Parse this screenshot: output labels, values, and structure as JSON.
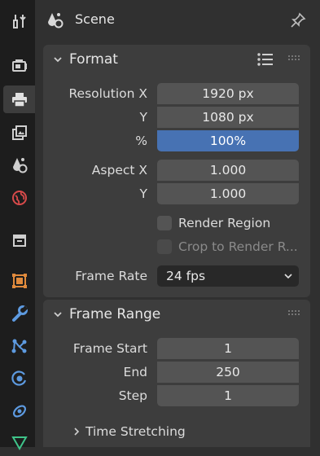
{
  "header": {
    "title": "Scene"
  },
  "tabs": [
    {
      "name": "tool-tab",
      "icon": "tool-icon"
    },
    {
      "name": "render-tab",
      "icon": "render-icon"
    },
    {
      "name": "output-tab",
      "icon": "output-icon",
      "active": true
    },
    {
      "name": "view-layer-tab",
      "icon": "view-layer-icon"
    },
    {
      "name": "scene-tab",
      "icon": "scene-icon"
    },
    {
      "name": "world-tab",
      "icon": "world-icon"
    },
    {
      "name": "collection-tab",
      "icon": "collection-icon"
    },
    {
      "name": "object-tab",
      "icon": "object-icon"
    },
    {
      "name": "modifier-tab",
      "icon": "wrench-icon"
    },
    {
      "name": "particles-tab",
      "icon": "particles-icon"
    },
    {
      "name": "physics-tab",
      "icon": "physics-icon"
    },
    {
      "name": "constraints-tab",
      "icon": "constraints-icon"
    },
    {
      "name": "data-tab",
      "icon": "data-icon"
    }
  ],
  "format": {
    "title": "Format",
    "resolution_x_label": "Resolution X",
    "resolution_x": "1920 px",
    "resolution_y_label": "Y",
    "resolution_y": "1080 px",
    "percent_label": "%",
    "percent": "100%",
    "aspect_x_label": "Aspect X",
    "aspect_x": "1.000",
    "aspect_y_label": "Y",
    "aspect_y": "1.000",
    "render_region": "Render Region",
    "render_region_checked": false,
    "crop": "Crop to Render R...",
    "crop_checked": false,
    "frame_rate_label": "Frame Rate",
    "frame_rate": "24 fps"
  },
  "frame_range": {
    "title": "Frame Range",
    "start_label": "Frame Start",
    "start": "1",
    "end_label": "End",
    "end": "250",
    "step_label": "Step",
    "step": "1",
    "time_stretching": "Time Stretching"
  },
  "colors": {
    "accent": "#4772b3",
    "field": "#545454",
    "panel": "#3d3d3d",
    "background": "#303030",
    "tab_bar": "#1d1d1d"
  }
}
